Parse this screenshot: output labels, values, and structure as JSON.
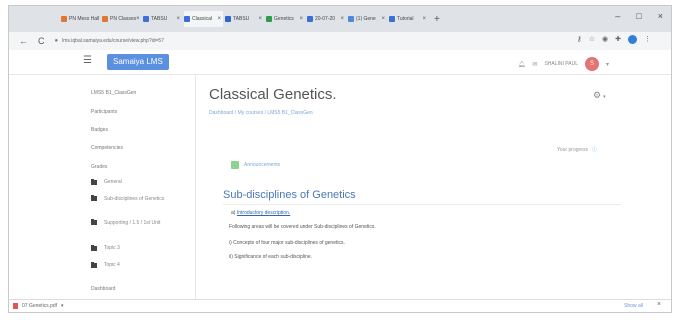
{
  "browser": {
    "tabs": [
      {
        "label": "PN Mess Hall",
        "color": "#e0762f"
      },
      {
        "label": "PN Classes",
        "color": "#e0762f"
      },
      {
        "label": "TABSU",
        "color": "#3e6fd6"
      },
      {
        "label": "Classical",
        "color": "#3e6fd6"
      },
      {
        "label": "TABSU",
        "color": "#2f66c9"
      },
      {
        "label": "Genetics",
        "color": "#2b9e4e"
      },
      {
        "label": "20-07-20",
        "color": "#3a70d2"
      },
      {
        "label": "(1) Gene",
        "color": "#4d88db"
      },
      {
        "label": "Tutorial",
        "color": "#3a70d2"
      }
    ],
    "new_tab": "+",
    "url": "lms.iqbal.samaiya.edu/course/view.php?id=57",
    "nav_back": "←",
    "nav_reload": "C",
    "window": {
      "minimize": "–",
      "maximize": "□",
      "close": "×"
    }
  },
  "navbar": {
    "brand": "Samaiya LMS",
    "menu_icon": "☰",
    "user_name": "SHALINI PAUL",
    "avatar_initial": "S",
    "dropdown_caret": "▾",
    "brand_color": "#5b8fe0"
  },
  "sidebar": {
    "course_short": "LMS5 B1_ClassGen",
    "participants": "Participants",
    "badges": "Badges",
    "competencies": "Competencies",
    "grades": "Grades",
    "sections": [
      "General",
      "Sub-disciplines of Genetics",
      "Supporting / 1.5 / 1st Unit",
      "Topic 3",
      "Topic 4"
    ],
    "dashboard": "Dashboard"
  },
  "main": {
    "title": "Classical Genetics.",
    "gear": "⚙",
    "gear_caret": "▾",
    "breadcrumb": "Dashboard / My courses / LMS5 B1_ClassGen",
    "your_progress": "Your progress",
    "progress_icon": "ⓘ",
    "announcements": "Announcements",
    "section_title": "Sub-disciplines of Genetics",
    "intro_prefix": "a)",
    "intro_link": "Introductory description.",
    "lines": [
      "Following areas will be covered under Sub-disciplines of Genetics.",
      "i) Concepts of four major sub-disciplines of genetics.",
      "ii) Significance of each sub-discipline."
    ]
  },
  "bottom": {
    "download_file": "07 Genetics.pdf",
    "download_caret": "▾",
    "show_all": "Show all",
    "close": "×"
  }
}
